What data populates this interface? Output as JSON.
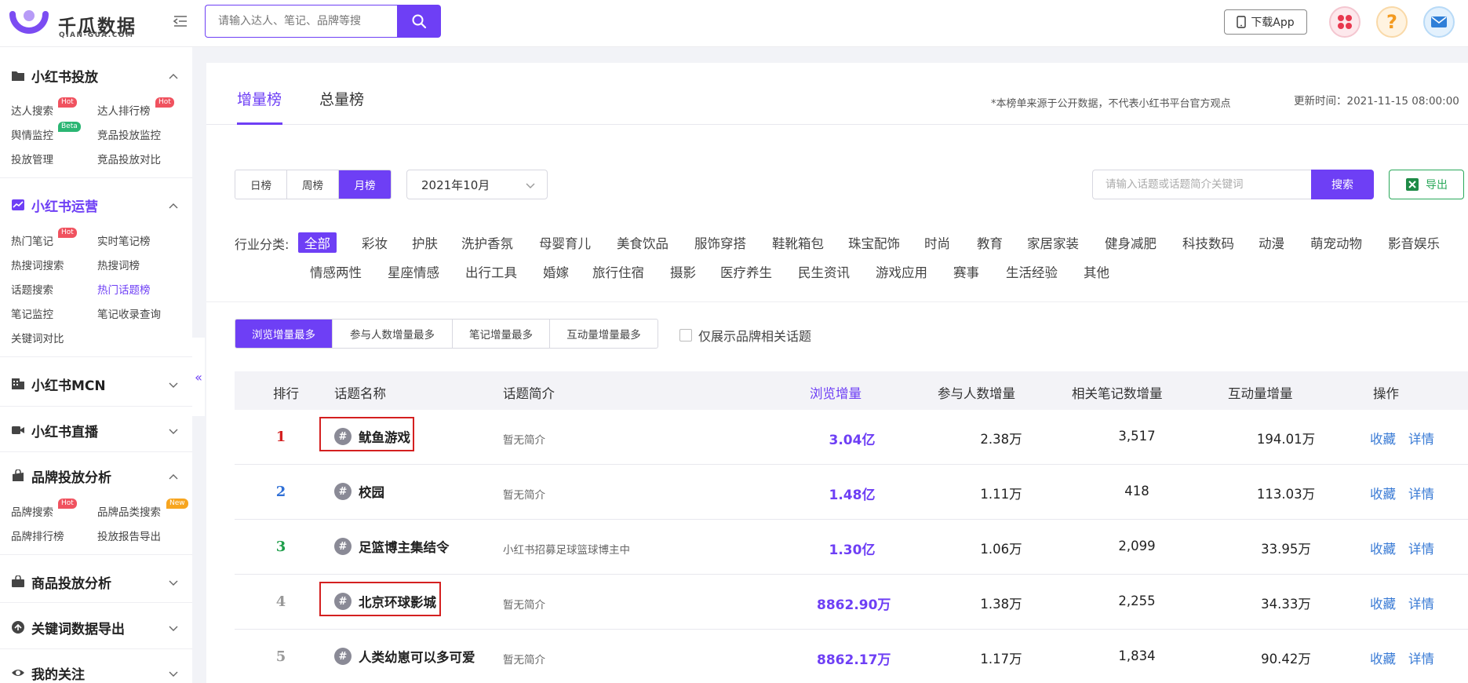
{
  "header": {
    "logo_name": "千瓜数据",
    "logo_sub": "QIAN-GUA.COM",
    "search_placeholder": "请输入达人、笔记、品牌等搜",
    "app_button": "下载App",
    "help_glyph": "?"
  },
  "sidebar": {
    "groups": [
      {
        "title": "小红书投放",
        "icon": "folder-icon",
        "expanded": true,
        "items": [
          {
            "label": "达人搜索",
            "tag": "Hot"
          },
          {
            "label": "达人排行榜",
            "tag": "Hot"
          },
          {
            "label": "舆情监控",
            "tag": "Beta"
          },
          {
            "label": "竞品投放监控"
          },
          {
            "label": "投放管理"
          },
          {
            "label": "竞品投放对比"
          }
        ]
      },
      {
        "title": "小红书运营",
        "icon": "trend-chart-icon",
        "expanded": true,
        "active": true,
        "items": [
          {
            "label": "热门笔记",
            "tag": "Hot"
          },
          {
            "label": "实时笔记榜"
          },
          {
            "label": "热搜词搜索"
          },
          {
            "label": "热搜词榜"
          },
          {
            "label": "话题搜索"
          },
          {
            "label": "热门话题榜",
            "active": true
          },
          {
            "label": "笔记监控"
          },
          {
            "label": "笔记收录查询"
          },
          {
            "label": "关键词对比"
          }
        ]
      },
      {
        "title": "小红书MCN",
        "icon": "building-icon",
        "expanded": false
      },
      {
        "title": "小红书直播",
        "icon": "video-icon",
        "expanded": false
      },
      {
        "title": "品牌投放分析",
        "icon": "bag-icon",
        "expanded": true,
        "items": [
          {
            "label": "品牌搜索",
            "tag": "Hot"
          },
          {
            "label": "品牌品类搜索",
            "tag": "New"
          },
          {
            "label": "品牌排行榜"
          },
          {
            "label": "投放报告导出"
          }
        ]
      },
      {
        "title": "商品投放分析",
        "icon": "shopping-bag-icon",
        "expanded": false
      },
      {
        "title": "关键词数据导出",
        "icon": "upload-icon",
        "expanded": false
      },
      {
        "title": "我的关注",
        "icon": "eye-icon",
        "expanded": false
      }
    ],
    "collapse_glyph": "«"
  },
  "tabs": [
    {
      "label": "增量榜",
      "active": true
    },
    {
      "label": "总量榜",
      "active": false
    }
  ],
  "note": "*本榜单来源于公开数据，不代表小红书平台官方观点",
  "update_time": "更新时间：2021-11-15 08:00:00",
  "period_tabs": [
    {
      "label": "日榜"
    },
    {
      "label": "周榜"
    },
    {
      "label": "月榜",
      "active": true
    }
  ],
  "month": "2021年10月",
  "keyword_placeholder": "请输入话题或话题简介关键词",
  "keyword_button": "搜索",
  "export_button": "导出",
  "industry_label": "行业分类:",
  "industries_row1": [
    "全部",
    "彩妆",
    "护肤",
    "洗护香氛",
    "母婴育儿",
    "美食饮品",
    "服饰穿搭",
    "鞋靴箱包",
    "珠宝配饰",
    "时尚",
    "教育",
    "家居家装",
    "健身减肥",
    "科技数码",
    "动漫",
    "萌宠动物",
    "影音娱乐"
  ],
  "industries_row2": [
    "情感两性",
    "星座情感",
    "出行工具",
    "婚嫁",
    "旅行住宿",
    "摄影",
    "医疗养生",
    "民生资讯",
    "游戏应用",
    "赛事",
    "生活经验",
    "其他"
  ],
  "sort_tabs": [
    {
      "label": "浏览增量最多",
      "active": true
    },
    {
      "label": "参与人数增量最多"
    },
    {
      "label": "笔记增量最多"
    },
    {
      "label": "互动量增量最多"
    }
  ],
  "brand_only_label": "仅展示品牌相关话题",
  "table": {
    "columns": [
      "排行",
      "话题名称",
      "话题简介",
      "浏览增量",
      "参与人数增量",
      "相关笔记数增量",
      "互动量增量",
      "操作"
    ],
    "rows": [
      {
        "rank": "1",
        "rank_color": "#d42020",
        "topic": "鱿鱼游戏",
        "intro": "暂无简介",
        "views": "3.04亿",
        "participants": "2.38万",
        "notes": "3,517",
        "interactions": "194.01万",
        "highlighted": true
      },
      {
        "rank": "2",
        "rank_color": "#2f6fd6",
        "topic": "校园",
        "intro": "暂无简介",
        "views": "1.48亿",
        "participants": "1.11万",
        "notes": "418",
        "interactions": "113.03万"
      },
      {
        "rank": "3",
        "rank_color": "#1e9e4a",
        "topic": "足篮博主集结令",
        "intro": "小红书招募足球篮球博主中",
        "views": "1.30亿",
        "participants": "1.06万",
        "notes": "2,099",
        "interactions": "33.95万"
      },
      {
        "rank": "4",
        "rank_color": "#999999",
        "topic": "北京环球影城",
        "intro": "暂无简介",
        "views": "8862.90万",
        "participants": "1.38万",
        "notes": "2,255",
        "interactions": "34.33万",
        "highlighted": true
      },
      {
        "rank": "5",
        "rank_color": "#999999",
        "topic": "人类幼崽可以多可爱",
        "intro": "暂无简介",
        "views": "8862.17万",
        "participants": "1.17万",
        "notes": "1,834",
        "interactions": "90.42万"
      }
    ],
    "action_favorite": "收藏",
    "action_detail": "详情"
  },
  "colors": {
    "accent": "#6e3ff5",
    "link": "#3a7bd5",
    "highlight_border": "#d42020",
    "export_green": "#2aa85a"
  }
}
